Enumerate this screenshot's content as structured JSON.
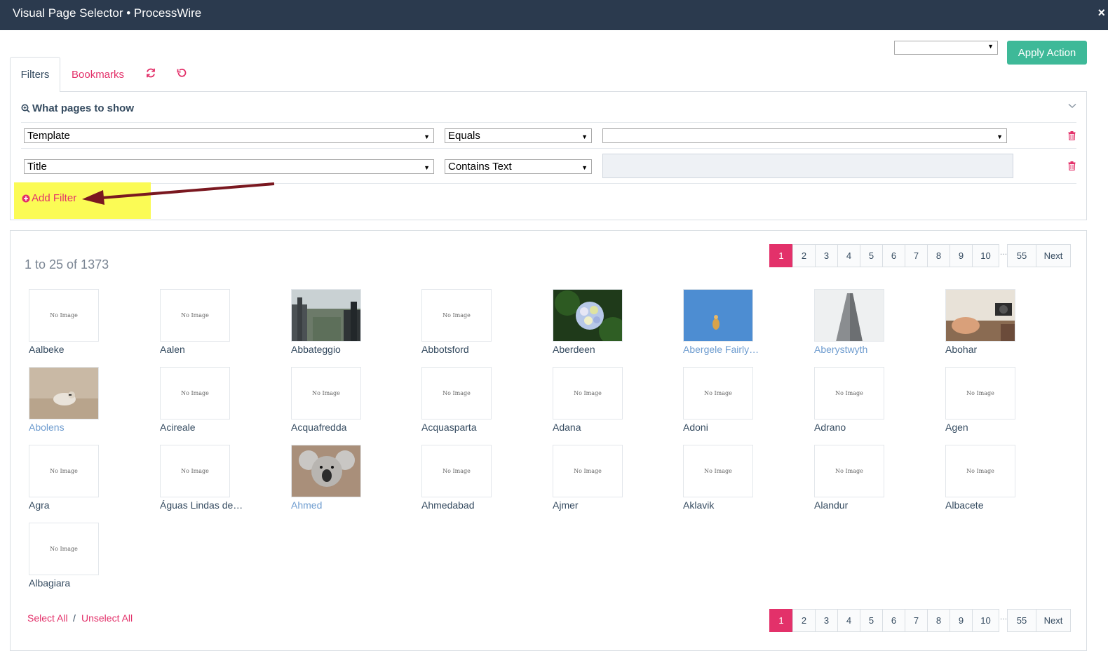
{
  "window": {
    "title": "Visual Page Selector • ProcessWire",
    "close_icon": "×"
  },
  "action_select": {
    "value": ""
  },
  "apply_button": {
    "label": "Apply Action"
  },
  "tabs": {
    "filters": "Filters",
    "bookmarks": "Bookmarks"
  },
  "filters": {
    "heading": "What pages to show",
    "rows": [
      {
        "field": "Template",
        "operator": "Equals",
        "value": ""
      },
      {
        "field": "Title",
        "operator": "Contains Text",
        "value": ""
      }
    ],
    "add_filter": "Add Filter"
  },
  "results": {
    "count_text": "1 to 25 of 1373",
    "pages": [
      "1",
      "2",
      "3",
      "4",
      "5",
      "6",
      "7",
      "8",
      "9",
      "10"
    ],
    "ellipsis": "…",
    "last_page": "55",
    "next": "Next",
    "current_page": "1",
    "no_image_text": "No Image",
    "items": [
      {
        "name": "Aalbeke",
        "image": "none"
      },
      {
        "name": "Aalen",
        "image": "none"
      },
      {
        "name": "Abbateggio",
        "image": "city"
      },
      {
        "name": "Abbotsford",
        "image": "none"
      },
      {
        "name": "Aberdeen",
        "image": "flower"
      },
      {
        "name": "Abergele Fairly…",
        "image": "pool"
      },
      {
        "name": "Aberystwyth",
        "image": "building"
      },
      {
        "name": "Abohar",
        "image": "desk"
      },
      {
        "name": "Abolens",
        "image": "bird"
      },
      {
        "name": "Acireale",
        "image": "none"
      },
      {
        "name": "Acquafredda",
        "image": "none"
      },
      {
        "name": "Acquasparta",
        "image": "none"
      },
      {
        "name": "Adana",
        "image": "none"
      },
      {
        "name": "Adoni",
        "image": "none"
      },
      {
        "name": "Adrano",
        "image": "none"
      },
      {
        "name": "Agen",
        "image": "none"
      },
      {
        "name": "Agra",
        "image": "none"
      },
      {
        "name": "Águas Lindas de…",
        "image": "none"
      },
      {
        "name": "Ahmed",
        "image": "koala"
      },
      {
        "name": "Ahmedabad",
        "image": "none"
      },
      {
        "name": "Ajmer",
        "image": "none"
      },
      {
        "name": "Aklavik",
        "image": "none"
      },
      {
        "name": "Alandur",
        "image": "none"
      },
      {
        "name": "Albacete",
        "image": "none"
      },
      {
        "name": "Albagiara",
        "image": "none"
      }
    ],
    "select_all": "Select All",
    "separator": "/",
    "unselect_all": "Unselect All"
  },
  "colors": {
    "accent": "#e3316a",
    "apply": "#3eb998",
    "titlebar": "#2b3a4e",
    "link_blue": "#6e9ccf"
  }
}
